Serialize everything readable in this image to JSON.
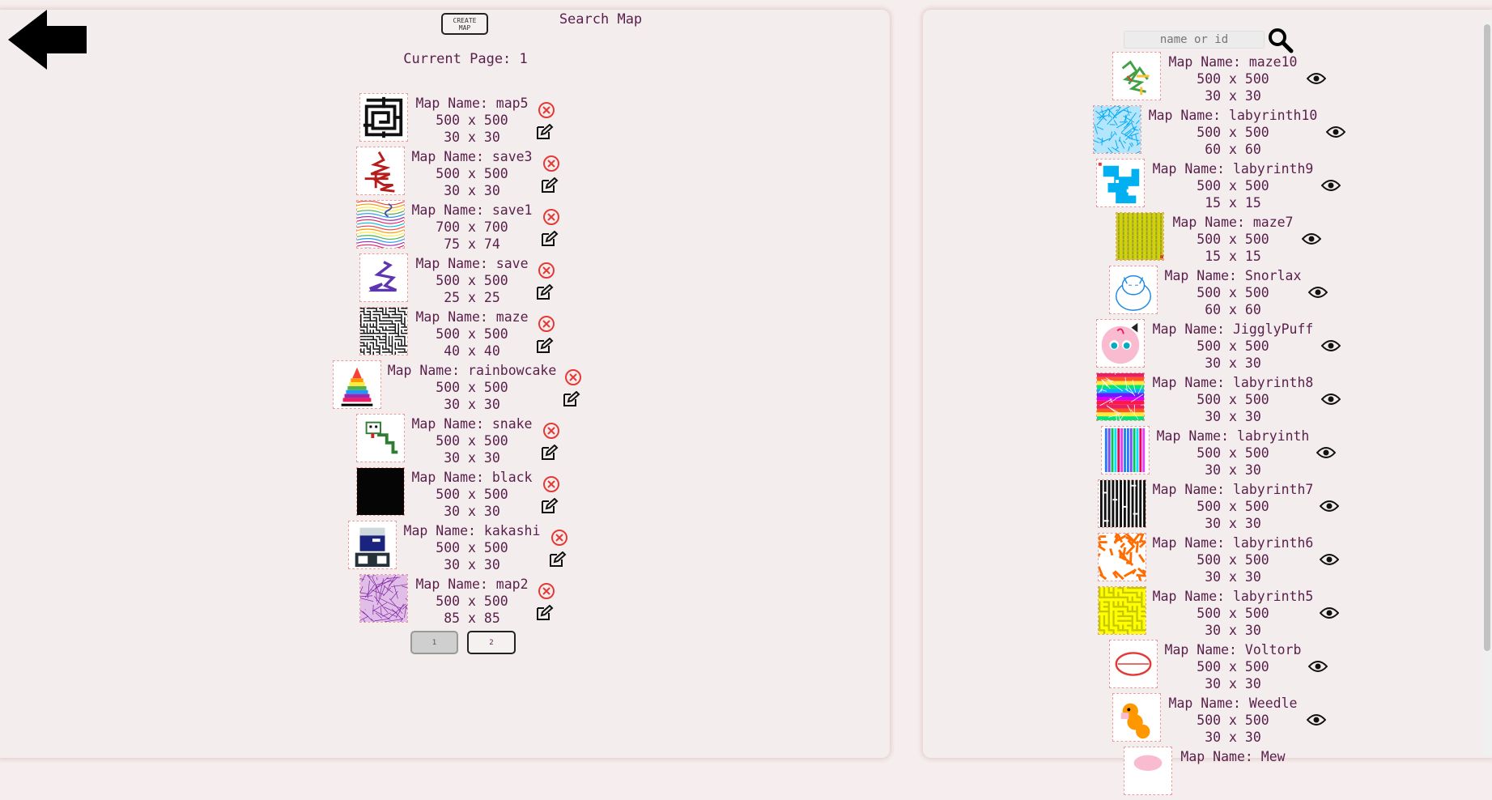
{
  "left": {
    "create_button": "CREATE MAP",
    "current_page": "Current Page: 1",
    "maps": [
      {
        "name": "Map Name: map5",
        "size": "500 x 500",
        "grid": "30 x 30",
        "thumb": "maze-black"
      },
      {
        "name": "Map Name: save3",
        "size": "500 x 500",
        "grid": "30 x 30",
        "thumb": "scribble-red"
      },
      {
        "name": "Map Name: save1",
        "size": "700 x 700",
        "grid": "75 x 74",
        "thumb": "rainbow-lines"
      },
      {
        "name": "Map Name: save",
        "size": "500 x 500",
        "grid": "25 x 25",
        "thumb": "scribble-purple"
      },
      {
        "name": "Map Name: maze",
        "size": "500 x 500",
        "grid": "40 x 40",
        "thumb": "maze-dense"
      },
      {
        "name": "Map Name: rainbowcake",
        "size": "500 x 500",
        "grid": "30 x 30",
        "thumb": "rainbow-cake"
      },
      {
        "name": "Map Name: snake",
        "size": "500 x 500",
        "grid": "30 x 30",
        "thumb": "snake-green"
      },
      {
        "name": "Map Name: black",
        "size": "500 x 500",
        "grid": "30 x 30",
        "thumb": "solid-black"
      },
      {
        "name": "Map Name: kakashi",
        "size": "500 x 500",
        "grid": "30 x 30",
        "thumb": "kakashi"
      },
      {
        "name": "Map Name: map2",
        "size": "500 x 500",
        "grid": "85 x 85",
        "thumb": "mesh-purple"
      }
    ],
    "pages": [
      "1",
      "2"
    ],
    "active_page": "1"
  },
  "right": {
    "title": "Search Map",
    "search_placeholder": "name or id",
    "maps": [
      {
        "name": "Map Name: maze10",
        "size": "500 x 500",
        "grid": "30 x 30",
        "thumb": "green-scribble"
      },
      {
        "name": "Map Name: labyrinth10",
        "size": "500 x 500",
        "grid": "60 x 60",
        "thumb": "cyan-scratch"
      },
      {
        "name": "Map Name: labyrinth9",
        "size": "500 x 500",
        "grid": "15 x 15",
        "thumb": "cyan-blocks"
      },
      {
        "name": "Map Name: maze7",
        "size": "500 x 500",
        "grid": "15 x 15",
        "thumb": "yellow-stripes"
      },
      {
        "name": "Map Name: Snorlax",
        "size": "500 x 500",
        "grid": "60 x 60",
        "thumb": "snorlax"
      },
      {
        "name": "Map Name: JigglyPuff",
        "size": "500 x 500",
        "grid": "30 x 30",
        "thumb": "jigglypuff"
      },
      {
        "name": "Map Name: labyrinth8",
        "size": "500 x 500",
        "grid": "30 x 30",
        "thumb": "rainbow-bands"
      },
      {
        "name": "Map Name: labryinth",
        "size": "500 x 500",
        "grid": "30 x 30",
        "thumb": "vertical-rainbow"
      },
      {
        "name": "Map Name: labyrinth7",
        "size": "500 x 500",
        "grid": "30 x 30",
        "thumb": "black-maze"
      },
      {
        "name": "Map Name: labyrinth6",
        "size": "500 x 500",
        "grid": "30 x 30",
        "thumb": "orange-scribble"
      },
      {
        "name": "Map Name: labyrinth5",
        "size": "500 x 500",
        "grid": "30 x 30",
        "thumb": "yellow-maze"
      },
      {
        "name": "Map Name: Voltorb",
        "size": "500 x 500",
        "grid": "30 x 30",
        "thumb": "voltorb"
      },
      {
        "name": "Map Name: Weedle",
        "size": "500 x 500",
        "grid": "30 x 30",
        "thumb": "weedle"
      },
      {
        "name": "Map Name: Mew",
        "size": "",
        "grid": "",
        "thumb": "mew"
      }
    ]
  },
  "colors": {
    "text": "#5a1f4a",
    "delete": "#e53935",
    "thumb_border": "#ef9a9a",
    "panel_bg": "#f3eded"
  }
}
